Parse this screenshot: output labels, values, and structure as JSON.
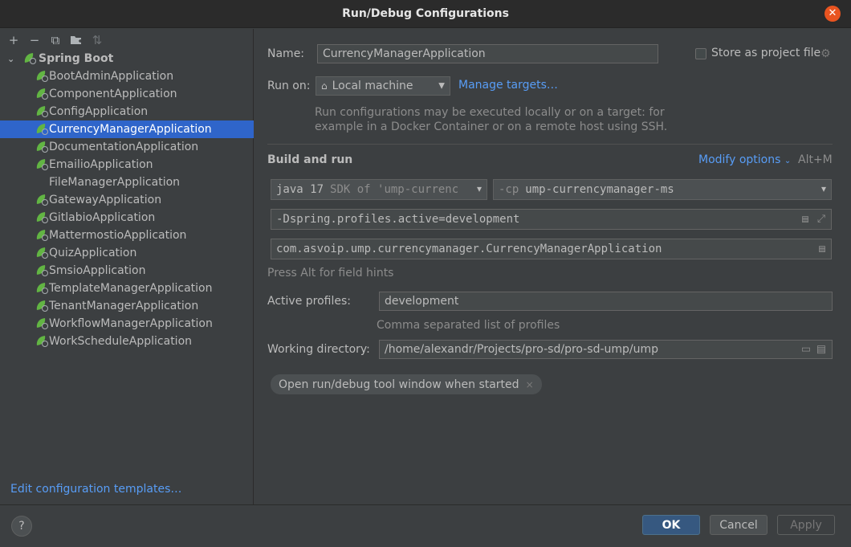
{
  "window": {
    "title": "Run/Debug Configurations",
    "close_label": "✕"
  },
  "toolbar": {
    "add": "+",
    "remove": "−",
    "copy": "⧉",
    "folder": "▆",
    "sort": "⇅"
  },
  "tree": {
    "root": {
      "label": "Spring Boot",
      "expanded": true
    },
    "items": [
      {
        "label": "BootAdminApplication",
        "icon": true,
        "selected": false
      },
      {
        "label": "ComponentApplication",
        "icon": true,
        "selected": false
      },
      {
        "label": "ConfigApplication",
        "icon": true,
        "selected": false
      },
      {
        "label": "CurrencyManagerApplication",
        "icon": true,
        "selected": true
      },
      {
        "label": "DocumentationApplication",
        "icon": true,
        "selected": false
      },
      {
        "label": "EmailioApplication",
        "icon": true,
        "selected": false
      },
      {
        "label": "FileManagerApplication",
        "icon": false,
        "selected": false
      },
      {
        "label": "GatewayApplication",
        "icon": true,
        "selected": false
      },
      {
        "label": "GitlabioApplication",
        "icon": true,
        "selected": false
      },
      {
        "label": "MattermostioApplication",
        "icon": true,
        "selected": false
      },
      {
        "label": "QuizApplication",
        "icon": true,
        "selected": false
      },
      {
        "label": "SmsioApplication",
        "icon": true,
        "selected": false
      },
      {
        "label": "TemplateManagerApplication",
        "icon": true,
        "selected": false
      },
      {
        "label": "TenantManagerApplication",
        "icon": true,
        "selected": false
      },
      {
        "label": "WorkflowManagerApplication",
        "icon": true,
        "selected": false
      },
      {
        "label": "WorkScheduleApplication",
        "icon": true,
        "selected": false
      }
    ],
    "edit_templates_link": "Edit configuration templates…"
  },
  "form": {
    "name_label": "Name:",
    "name_value": "CurrencyManagerApplication",
    "store_label": "Store as project file",
    "store_checked": false,
    "run_on_label": "Run on:",
    "run_on_value": "Local machine",
    "manage_targets": "Manage targets…",
    "run_on_hint_1": "Run configurations may be executed locally or on a target: for",
    "run_on_hint_2": "example in a Docker Container or on a remote host using SSH.",
    "build_run_title": "Build and run",
    "modify_options": "Modify options",
    "modify_shortcut": "Alt+M",
    "jdk_prefix": "java 17",
    "jdk_value": "SDK of 'ump-currenc",
    "cp_prefix": "-cp",
    "cp_value": "ump-currencymanager-ms",
    "vm_options": "-Dspring.profiles.active=development",
    "main_class": "com.asvoip.ump.currencymanager.CurrencyManagerApplication",
    "field_hints": "Press Alt for field hints",
    "profiles_label": "Active profiles:",
    "profiles_value": "development",
    "profiles_hint": "Comma separated list of profiles",
    "workdir_label": "Working directory:",
    "workdir_value": "/home/alexandr/Projects/pro-sd/pro-sd-ump/ump",
    "chip_label": "Open run/debug tool window when started",
    "chip_remove": "×"
  },
  "footer": {
    "help": "?",
    "ok": "OK",
    "cancel": "Cancel",
    "apply": "Apply"
  }
}
